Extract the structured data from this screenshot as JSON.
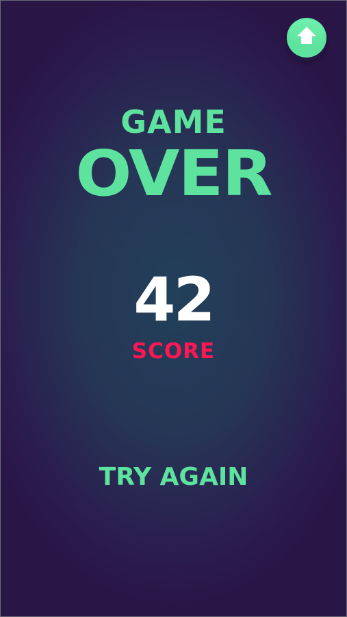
{
  "game_over": {
    "line1": "GAME",
    "line2": "OVER"
  },
  "score": {
    "value": "42",
    "label": "SCORE"
  },
  "actions": {
    "try_again_label": "TRY AGAIN",
    "home_icon": "home-icon"
  },
  "colors": {
    "accent_green": "#5ee39f",
    "score_label_red": "#ff1654",
    "score_value_white": "#ffffff",
    "background_center": "#22405a",
    "background_edge": "#2a1547"
  }
}
